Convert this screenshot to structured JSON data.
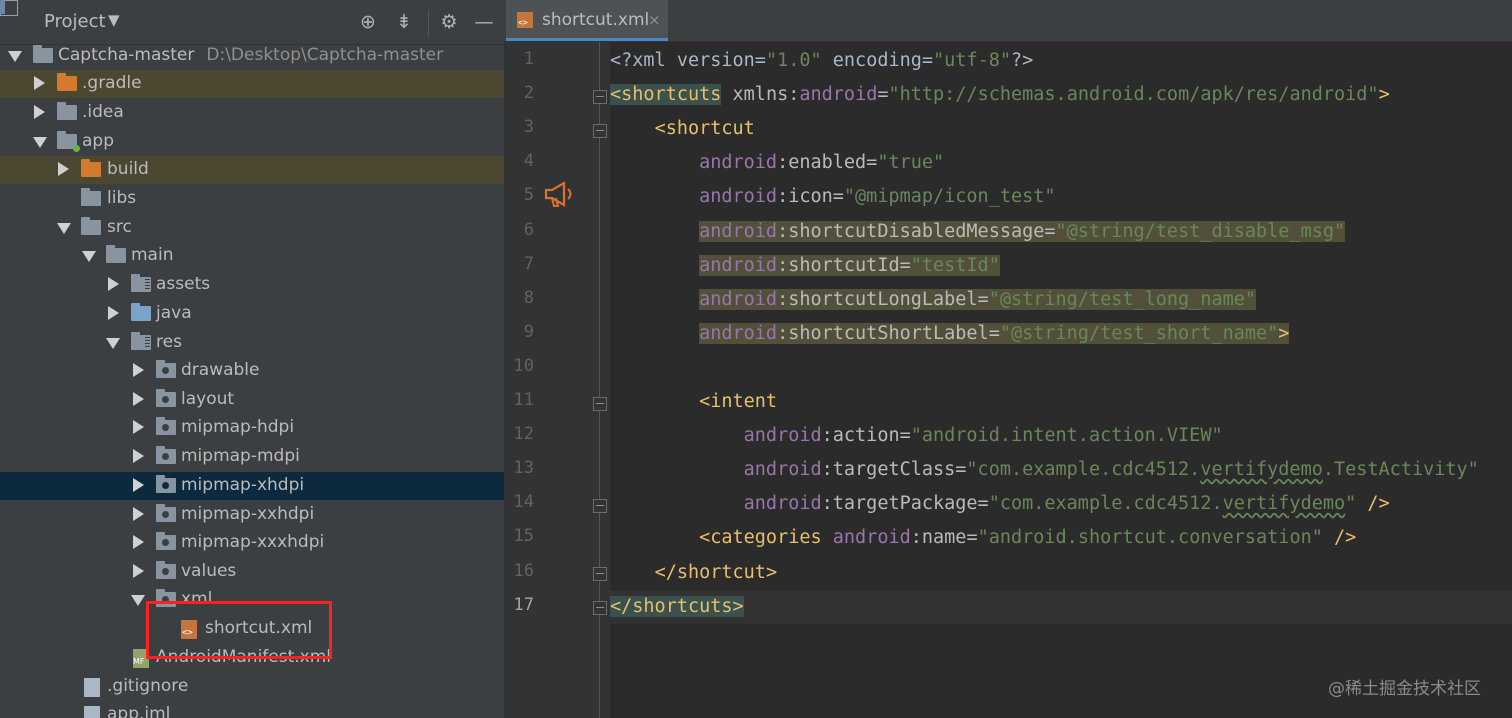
{
  "project_panel": {
    "title": "Project",
    "icons": [
      "project-view-icon",
      "target-icon",
      "collapse-all-icon",
      "gear-icon",
      "minimize-icon"
    ],
    "tree": [
      {
        "label": "Captcha-master",
        "path": "D:\\Desktop\\Captcha-master"
      },
      {
        "label": ".gradle"
      },
      {
        "label": ".idea"
      },
      {
        "label": "app"
      },
      {
        "label": "build"
      },
      {
        "label": "libs"
      },
      {
        "label": "src"
      },
      {
        "label": "main"
      },
      {
        "label": "assets"
      },
      {
        "label": "java"
      },
      {
        "label": "res"
      },
      {
        "label": "drawable"
      },
      {
        "label": "layout"
      },
      {
        "label": "mipmap-hdpi"
      },
      {
        "label": "mipmap-mdpi"
      },
      {
        "label": "mipmap-xhdpi"
      },
      {
        "label": "mipmap-xxhdpi"
      },
      {
        "label": "mipmap-xxxhdpi"
      },
      {
        "label": "values"
      },
      {
        "label": "xml"
      },
      {
        "label": "shortcut.xml"
      },
      {
        "label": "AndroidManifest.xml"
      },
      {
        "label": ".gitignore"
      },
      {
        "label": "app.iml"
      }
    ]
  },
  "editor": {
    "tab": {
      "label": "shortcut.xml",
      "close": "×"
    },
    "line_numbers": [
      "1",
      "2",
      "3",
      "4",
      "5",
      "6",
      "7",
      "8",
      "9",
      "10",
      "11",
      "12",
      "13",
      "14",
      "15",
      "16",
      "17"
    ],
    "lines": [
      [
        {
          "t": "<?xml version=",
          "c": "t-plain"
        },
        {
          "t": "\"1.0\"",
          "c": "t-str"
        },
        {
          "t": " encoding=",
          "c": "t-plain"
        },
        {
          "t": "\"utf-8\"",
          "c": "t-str"
        },
        {
          "t": "?>",
          "c": "t-plain"
        }
      ],
      [
        {
          "t": "<shortcuts",
          "c": "t-tag hl-green"
        },
        {
          "t": " ",
          "c": "t-plain"
        },
        {
          "t": "xmlns",
          "c": "t-attr"
        },
        {
          "t": ":",
          "c": "t-plain"
        },
        {
          "t": "android",
          "c": "t-ns"
        },
        {
          "t": "=",
          "c": "t-plain"
        },
        {
          "t": "\"http://schemas.android.com/apk/res/android\"",
          "c": "t-str"
        },
        {
          "t": ">",
          "c": "t-tag"
        }
      ],
      [
        {
          "t": "    ",
          "c": "t-plain"
        },
        {
          "t": "<shortcut",
          "c": "t-tag"
        }
      ],
      [
        {
          "t": "        ",
          "c": "t-plain"
        },
        {
          "t": "android",
          "c": "t-ns"
        },
        {
          "t": ":enabled=",
          "c": "t-attr"
        },
        {
          "t": "\"true\"",
          "c": "t-str"
        }
      ],
      [
        {
          "t": "        ",
          "c": "t-plain"
        },
        {
          "t": "android",
          "c": "t-ns"
        },
        {
          "t": ":icon=",
          "c": "t-attr"
        },
        {
          "t": "\"@mipmap/icon_test\"",
          "c": "t-str"
        }
      ],
      [
        {
          "t": "        ",
          "c": "t-plain"
        },
        {
          "t": "android",
          "c": "t-ns hl"
        },
        {
          "t": ":shortcutDisabledMessage=",
          "c": "t-attr hl"
        },
        {
          "t": "\"@string/test_disable_msg\"",
          "c": "t-str hl"
        }
      ],
      [
        {
          "t": "        ",
          "c": "t-plain"
        },
        {
          "t": "android",
          "c": "t-ns hl"
        },
        {
          "t": ":shortcutId=",
          "c": "t-attr hl"
        },
        {
          "t": "\"testId\"",
          "c": "t-str hl"
        }
      ],
      [
        {
          "t": "        ",
          "c": "t-plain"
        },
        {
          "t": "android",
          "c": "t-ns hl"
        },
        {
          "t": ":shortcutLongLabel=",
          "c": "t-attr hl"
        },
        {
          "t": "\"@string/test_long_name\"",
          "c": "t-str hl"
        }
      ],
      [
        {
          "t": "        ",
          "c": "t-plain"
        },
        {
          "t": "android",
          "c": "t-ns hl"
        },
        {
          "t": ":shortcutShortLabel=",
          "c": "t-attr hl"
        },
        {
          "t": "\"@string/test_short_name\"",
          "c": "t-str hl"
        },
        {
          "t": ">",
          "c": "t-tag hl"
        }
      ],
      [
        {
          "t": "",
          "c": "t-plain"
        }
      ],
      [
        {
          "t": "        ",
          "c": "t-plain"
        },
        {
          "t": "<intent",
          "c": "t-tag"
        }
      ],
      [
        {
          "t": "            ",
          "c": "t-plain"
        },
        {
          "t": "android",
          "c": "t-ns"
        },
        {
          "t": ":action=",
          "c": "t-attr"
        },
        {
          "t": "\"android.intent.action.VIEW\"",
          "c": "t-str"
        }
      ],
      [
        {
          "t": "            ",
          "c": "t-plain"
        },
        {
          "t": "android",
          "c": "t-ns"
        },
        {
          "t": ":targetClass=",
          "c": "t-attr"
        },
        {
          "t": "\"com.example.cdc4512.",
          "c": "t-str"
        },
        {
          "t": "vertifydemo",
          "c": "t-str squig"
        },
        {
          "t": ".TestActivity\"",
          "c": "t-str"
        }
      ],
      [
        {
          "t": "            ",
          "c": "t-plain"
        },
        {
          "t": "android",
          "c": "t-ns"
        },
        {
          "t": ":targetPackage=",
          "c": "t-attr"
        },
        {
          "t": "\"com.example.cdc4512.",
          "c": "t-str"
        },
        {
          "t": "vertifydemo",
          "c": "t-str squig"
        },
        {
          "t": "\"",
          "c": "t-str"
        },
        {
          "t": " />",
          "c": "t-tag"
        }
      ],
      [
        {
          "t": "        ",
          "c": "t-plain"
        },
        {
          "t": "<categories",
          "c": "t-tag"
        },
        {
          "t": " ",
          "c": "t-plain"
        },
        {
          "t": "android",
          "c": "t-ns"
        },
        {
          "t": ":name=",
          "c": "t-attr"
        },
        {
          "t": "\"android.shortcut.conversation\"",
          "c": "t-str"
        },
        {
          "t": " />",
          "c": "t-tag"
        }
      ],
      [
        {
          "t": "    ",
          "c": "t-plain"
        },
        {
          "t": "</shortcut>",
          "c": "t-tag"
        }
      ],
      [
        {
          "t": "</shortcuts>",
          "c": "t-tag hl-green"
        }
      ]
    ]
  },
  "watermark": "@稀土掘金技术社区",
  "colors": {
    "panel_bg": "#3c3f41",
    "editor_bg": "#2b2b2b",
    "tag": "#e8bf6a",
    "string": "#6a8759",
    "namespace": "#9876aa",
    "selection": "#0d293e",
    "annotation_box": "#ff2020"
  }
}
